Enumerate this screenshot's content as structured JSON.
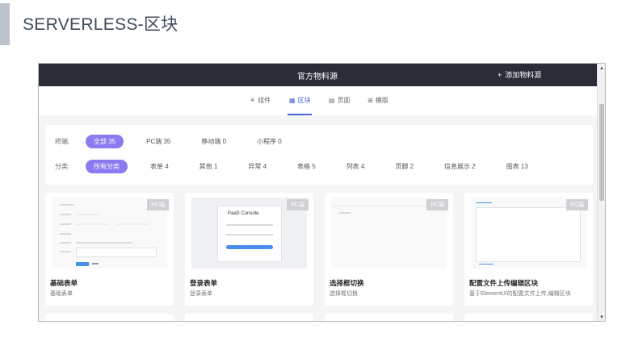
{
  "slide": {
    "title": "SERVERLESS-区块"
  },
  "topbar": {
    "title": "官方物料源",
    "add_label": "添加物料源",
    "add_icon": "+"
  },
  "tabs": [
    {
      "icon": "⚘",
      "label": "组件"
    },
    {
      "icon": "▦",
      "label": "区块"
    },
    {
      "icon": "▤",
      "label": "页面"
    },
    {
      "icon": "⊞",
      "label": "模版"
    }
  ],
  "active_tab": "区块",
  "filters": {
    "platform": {
      "label": "终端:",
      "options": [
        "全部 35",
        "PC端 35",
        "移动端 0",
        "小程序 0"
      ],
      "selected": "全部 35"
    },
    "category": {
      "label": "分类:",
      "options": [
        "所有分类",
        "表单 4",
        "其他 1",
        "异常 4",
        "表格 5",
        "列表 4",
        "页脚 2",
        "信息展示 2",
        "图表 13"
      ],
      "selected": "所有分类"
    }
  },
  "cards": [
    {
      "badge": "PC端",
      "title": "基础表单",
      "desc": "基础表单"
    },
    {
      "badge": "PC端",
      "title": "登录表单",
      "desc": "登录表单",
      "thumb_text": "PaaS Console"
    },
    {
      "badge": "PC端",
      "title": "选择框切换",
      "desc": "选择框切换"
    },
    {
      "badge": "PC端",
      "title": "配置文件上传编辑区块",
      "desc": "基于ElementUI的配置文件上传,编辑区块"
    }
  ],
  "colors": {
    "topbar": "#2a2d38",
    "accent": "#4a65d9",
    "pill_active": "#8a7cf0"
  }
}
